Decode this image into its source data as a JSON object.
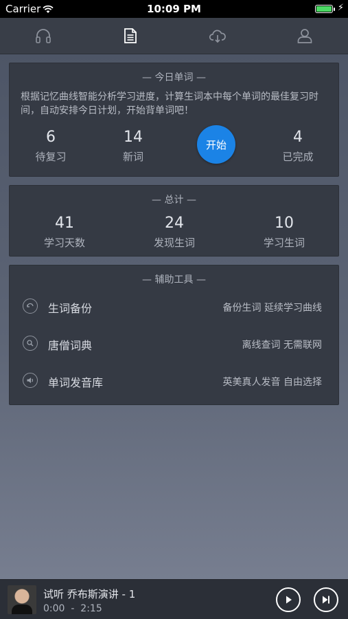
{
  "status_bar": {
    "carrier": "Carrier",
    "time": "10:09 PM"
  },
  "tabs": [
    {
      "icon": "headphones-icon"
    },
    {
      "icon": "document-icon",
      "active": true
    },
    {
      "icon": "cloud-download-icon"
    },
    {
      "icon": "user-icon"
    }
  ],
  "today": {
    "title": "— 今日单词 —",
    "description": "根据记忆曲线智能分析学习进度，计算生词本中每个单词的最佳复习时间，自动安排今日计划，开始背单词吧！",
    "stats": [
      {
        "value": "6",
        "label": "待复习"
      },
      {
        "value": "14",
        "label": "新词"
      },
      {
        "value": "4",
        "label": "已完成"
      }
    ],
    "start_label": "开始"
  },
  "total": {
    "title": "— 总计 —",
    "stats": [
      {
        "value": "41",
        "label": "学习天数"
      },
      {
        "value": "24",
        "label": "发现生词"
      },
      {
        "value": "10",
        "label": "学习生词"
      }
    ]
  },
  "tools": {
    "title": "— 辅助工具 —",
    "items": [
      {
        "icon": "backup-icon",
        "name": "生词备份",
        "desc": "备份生词 延续学习曲线"
      },
      {
        "icon": "search-icon",
        "name": "唐僧词典",
        "desc": "离线查词 无需联网"
      },
      {
        "icon": "speaker-icon",
        "name": "单词发音库",
        "desc": "英美真人发音 自由选择"
      }
    ]
  },
  "player": {
    "title": "试听 乔布斯演讲 - 1",
    "time": "0:00  -  2:15"
  },
  "colors": {
    "accent": "#1b83e6",
    "card": "#353a44",
    "tabbar": "#393e48"
  }
}
